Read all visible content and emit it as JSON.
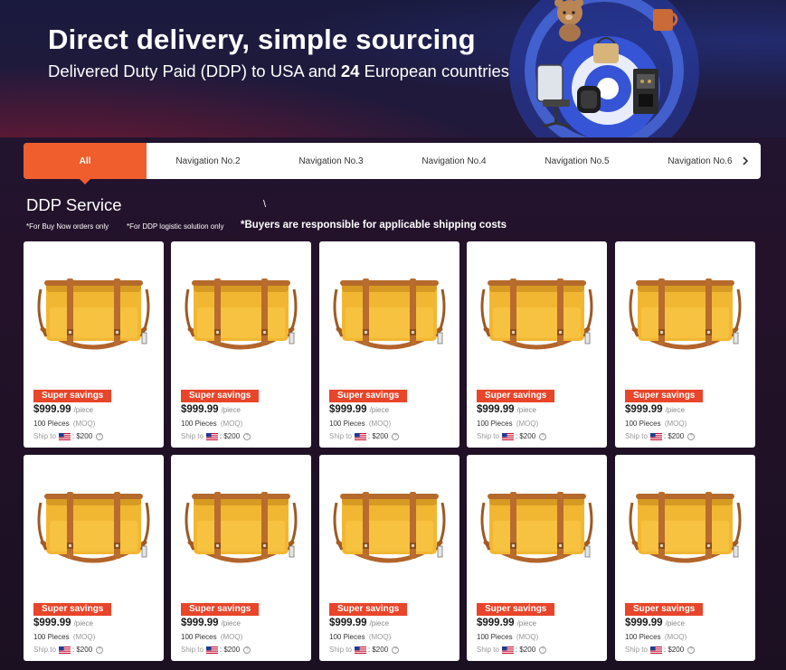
{
  "banner": {
    "title": "Direct delivery, simple sourcing",
    "subtitle_pre": "Delivered Duty Paid (DDP) to USA and ",
    "subtitle_count": "24",
    "subtitle_post": " European countries"
  },
  "nav": {
    "items": [
      {
        "label": "All",
        "active": true
      },
      {
        "label": "Navigation No.2"
      },
      {
        "label": "Navigation No.3"
      },
      {
        "label": "Navigation No.4"
      },
      {
        "label": "Navigation No.5"
      },
      {
        "label": "Navigation No.6"
      }
    ],
    "next_icon": "chevron-right-icon"
  },
  "section": {
    "title": "DDP Service",
    "note1": "*For Buy Now orders only",
    "note2": "*For DDP logistic solution only",
    "note3": "*Buyers are responsible for applicable shipping costs"
  },
  "products": [
    {
      "badge": "Super savings",
      "price": "$999.99",
      "unit": "/piece",
      "moq_value": "100 Pieces",
      "moq_label": "(MOQ)",
      "ship_label": "Ship to",
      "ship_cost": ": $200"
    },
    {
      "badge": "Super savings",
      "price": "$999.99",
      "unit": "/piece",
      "moq_value": "100 Pieces",
      "moq_label": "(MOQ)",
      "ship_label": "Ship to",
      "ship_cost": ": $200"
    },
    {
      "badge": "Super savings",
      "price": "$999.99",
      "unit": "/piece",
      "moq_value": "100 Pieces",
      "moq_label": "(MOQ)",
      "ship_label": "Ship to",
      "ship_cost": ": $200"
    },
    {
      "badge": "Super savings",
      "price": "$999.99",
      "unit": "/piece",
      "moq_value": "100 Pieces",
      "moq_label": "(MOQ)",
      "ship_label": "Ship to",
      "ship_cost": ": $200"
    },
    {
      "badge": "Super savings",
      "price": "$999.99",
      "unit": "/piece",
      "moq_value": "100 Pieces",
      "moq_label": "(MOQ)",
      "ship_label": "Ship to",
      "ship_cost": ": $200"
    },
    {
      "badge": "Super savings",
      "price": "$999.99",
      "unit": "/piece",
      "moq_value": "100 Pieces",
      "moq_label": "(MOQ)",
      "ship_label": "Ship to",
      "ship_cost": ": $200"
    },
    {
      "badge": "Super savings",
      "price": "$999.99",
      "unit": "/piece",
      "moq_value": "100 Pieces",
      "moq_label": "(MOQ)",
      "ship_label": "Ship to",
      "ship_cost": ": $200"
    },
    {
      "badge": "Super savings",
      "price": "$999.99",
      "unit": "/piece",
      "moq_value": "100 Pieces",
      "moq_label": "(MOQ)",
      "ship_label": "Ship to",
      "ship_cost": ": $200"
    },
    {
      "badge": "Super savings",
      "price": "$999.99",
      "unit": "/piece",
      "moq_value": "100 Pieces",
      "moq_label": "(MOQ)",
      "ship_label": "Ship to",
      "ship_cost": ": $200"
    },
    {
      "badge": "Super savings",
      "price": "$999.99",
      "unit": "/piece",
      "moq_value": "100 Pieces",
      "moq_label": "(MOQ)",
      "ship_label": "Ship to",
      "ship_cost": ": $200"
    }
  ],
  "colors": {
    "accent": "#ef5e2c",
    "badge": "#e8452a",
    "banner_bg": "#1a1a3e",
    "page_bg": "#24122a"
  },
  "icons": {
    "product_image": "yellow-messenger-bag",
    "ship_flag": "usa-flag-icon",
    "info": "question-circle-icon"
  }
}
